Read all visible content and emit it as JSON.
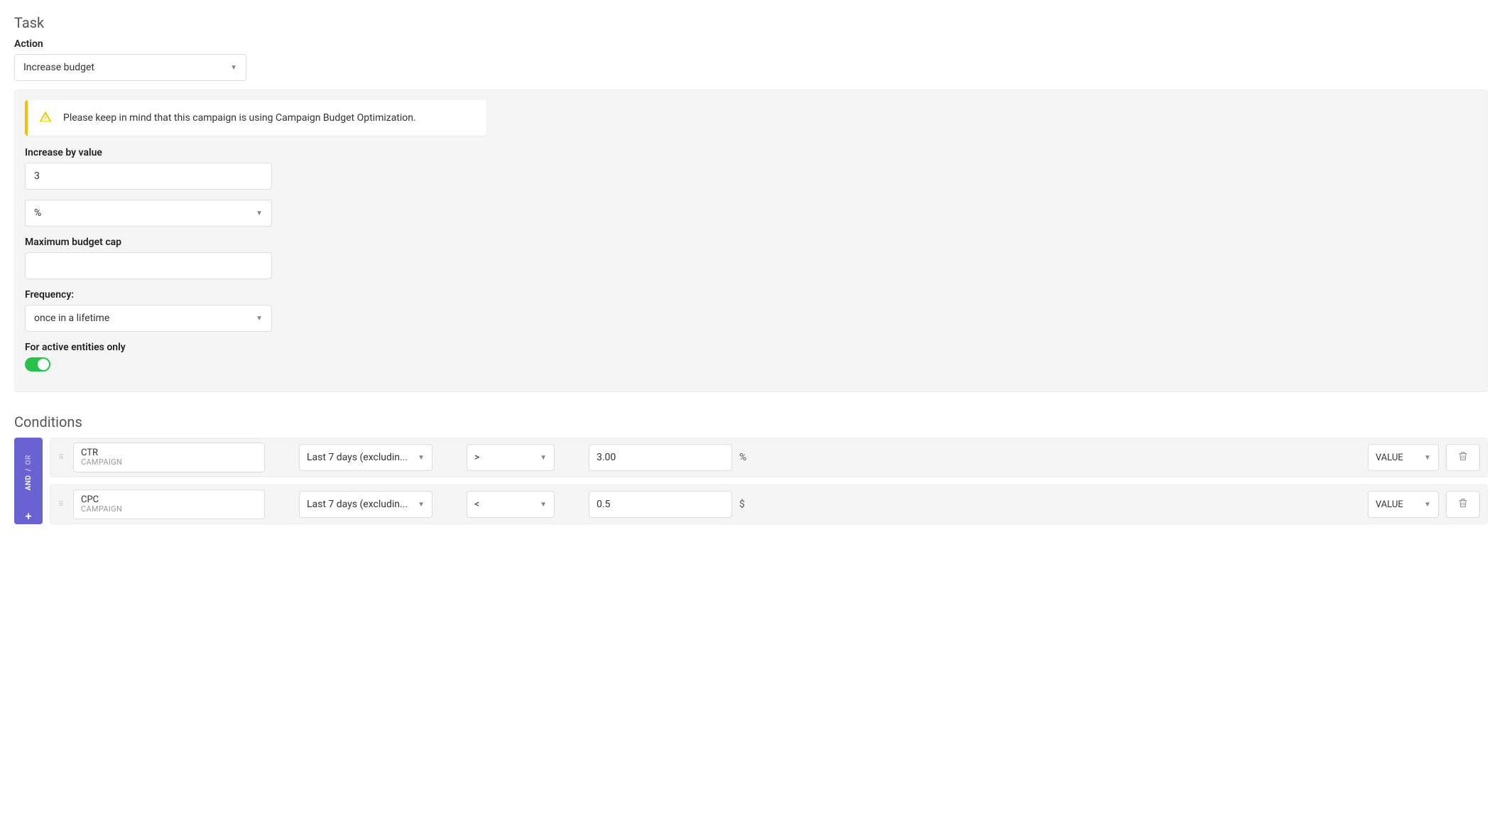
{
  "task": {
    "title": "Task",
    "action_label": "Action",
    "action_value": "Increase budget"
  },
  "alert": {
    "text": "Please keep in mind that this campaign is using Campaign Budget Optimization."
  },
  "increase": {
    "label": "Increase by value",
    "value": "3",
    "unit_selected": "%"
  },
  "max_cap": {
    "label": "Maximum budget cap",
    "value": ""
  },
  "frequency": {
    "label": "Frequency:",
    "value": "once in a lifetime"
  },
  "active_only": {
    "label": "For active entities only",
    "enabled": true
  },
  "conditions": {
    "title": "Conditions",
    "logic_and": "AND",
    "logic_or": "OR",
    "logic_sep": "/",
    "add_label": "+",
    "value_type": "VALUE",
    "rows": [
      {
        "metric": "CTR",
        "level": "CAMPAIGN",
        "timeframe": "Last 7 days (excludin...",
        "operator": ">",
        "value": "3.00",
        "unit": "%"
      },
      {
        "metric": "CPC",
        "level": "CAMPAIGN",
        "timeframe": "Last 7 days (excludin...",
        "operator": "<",
        "value": "0.5",
        "unit": "$"
      }
    ]
  }
}
